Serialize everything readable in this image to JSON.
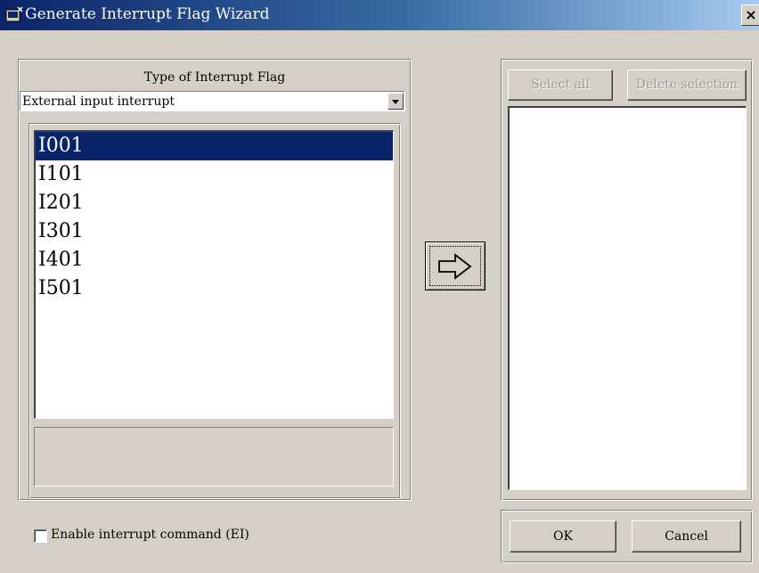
{
  "window": {
    "title": "Generate Interrupt Flag Wizard",
    "close_glyph": "×",
    "icon": "app-window-icon"
  },
  "left_group": {
    "title": "Type of Interrupt Flag",
    "dropdown_value": "External input interrupt",
    "list_items": [
      "I001",
      "I101",
      "I201",
      "I301",
      "I401",
      "I501"
    ],
    "selected_index": 0
  },
  "transfer": {
    "icon": "arrow-right-icon"
  },
  "right_group": {
    "select_all_label": "Select all",
    "delete_selection_label": "Delete selection",
    "list_items": []
  },
  "footer": {
    "checkbox_label": "Enable interrupt command (EI)",
    "checkbox_checked": false,
    "ok_label": "OK",
    "cancel_label": "Cancel"
  },
  "colors": {
    "face": "#d4d0c8",
    "selection": "#0a246a",
    "title_start": "#0a246a",
    "title_end": "#a6caf0"
  }
}
